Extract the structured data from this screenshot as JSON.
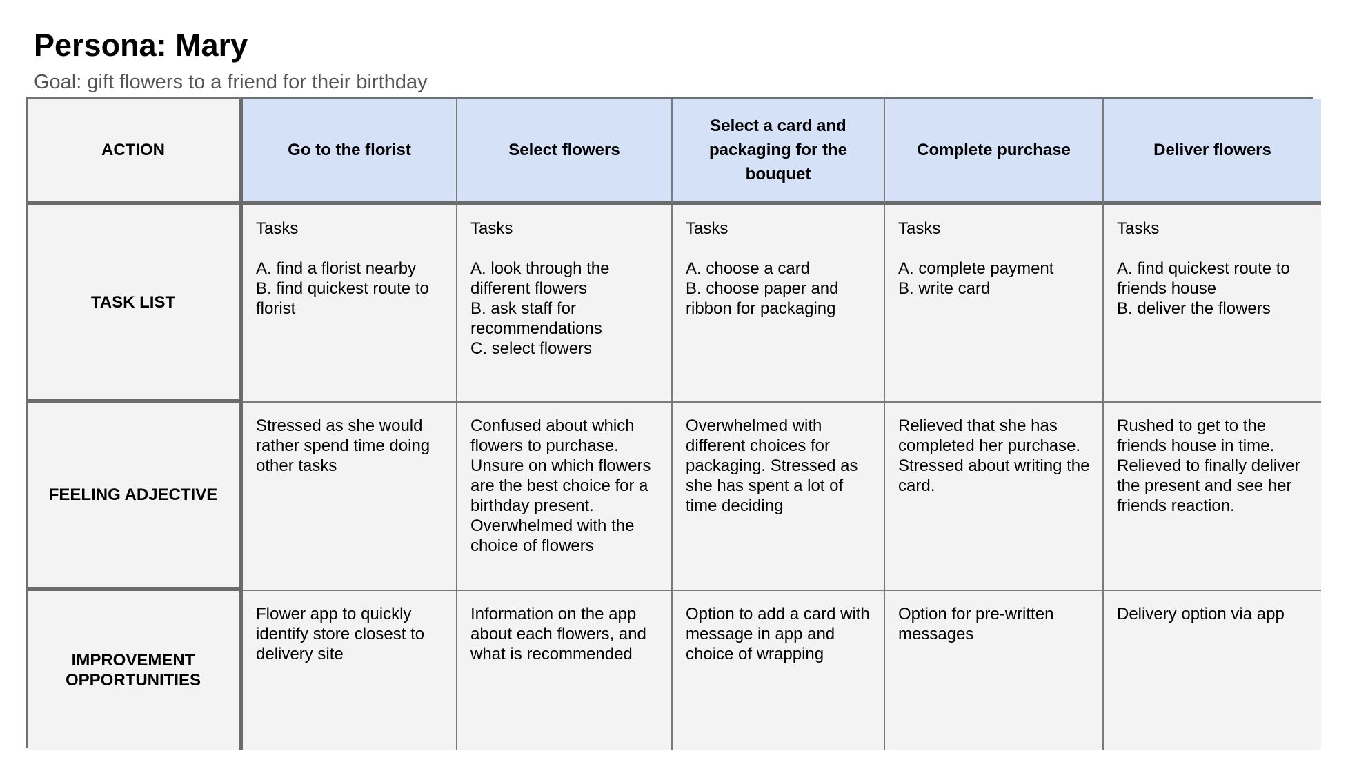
{
  "header": {
    "title": "Persona: Mary",
    "goal": "Goal: gift flowers to a friend for their birthday"
  },
  "colors": {
    "header_fill": "#d5e1f7",
    "cell_fill": "#f3f3f3",
    "border": "#7a7a7a",
    "thick_border": "#6b6b6b",
    "subtitle_text": "#555555"
  },
  "table": {
    "row_labels": [
      "ACTION",
      "TASK LIST",
      "FEELING ADJECTIVE",
      "IMPROVEMENT OPPORTUNITIES"
    ],
    "columns": [
      {
        "action": "Go to the florist",
        "tasks_label": "Tasks",
        "tasks": [
          "A. find a florist nearby",
          "B. find quickest route to florist"
        ],
        "feeling": "Stressed as she would rather spend time doing other tasks",
        "improvement": "Flower app to quickly identify store closest to delivery site"
      },
      {
        "action": "Select flowers",
        "tasks_label": "Tasks",
        "tasks": [
          "A. look through the different flowers",
          "B. ask staff for recommendations",
          "C. select flowers"
        ],
        "feeling": "Confused about which flowers to purchase. Unsure on which flowers are the best choice for a birthday present. Overwhelmed with the choice of flowers",
        "improvement": "Information on the app about each flowers, and what is recommended"
      },
      {
        "action": "Select a card and packaging for the bouquet",
        "tasks_label": "Tasks",
        "tasks": [
          "A. choose a card",
          "B. choose paper and ribbon for packaging"
        ],
        "feeling": "Overwhelmed with different choices for packaging. Stressed as she has spent a lot of time deciding",
        "improvement": "Option to add a card with message in app and choice of wrapping"
      },
      {
        "action": "Complete purchase",
        "tasks_label": "Tasks",
        "tasks": [
          "A. complete payment",
          "B. write card"
        ],
        "feeling": "Relieved that she has completed her purchase. Stressed about writing the card.",
        "improvement": "Option for pre-written messages"
      },
      {
        "action": "Deliver flowers",
        "tasks_label": "Tasks",
        "tasks": [
          "A. find quickest route to friends house",
          "B. deliver the flowers"
        ],
        "feeling": "Rushed to get to the friends house in time. Relieved to finally deliver the present and see her friends reaction.",
        "improvement": "Delivery option via app"
      }
    ]
  }
}
